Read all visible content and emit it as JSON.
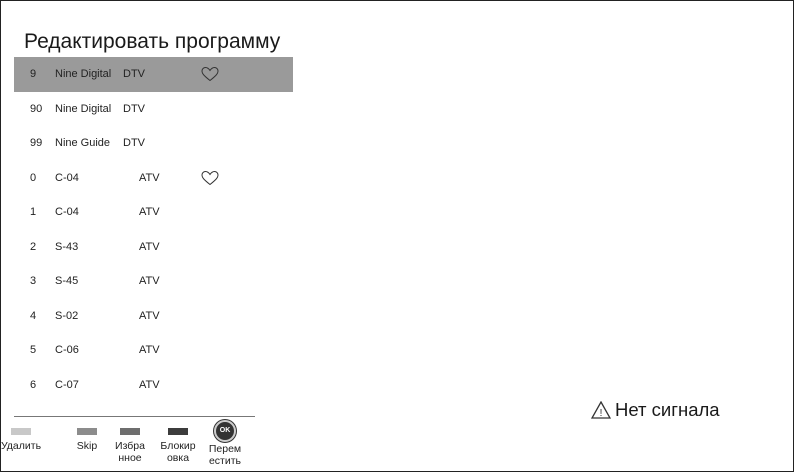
{
  "screen": {
    "title": "Редактировать программу"
  },
  "channels": [
    {
      "num": "9",
      "name": "Nine Digital",
      "type": "DTV",
      "fav": true,
      "selected": true
    },
    {
      "num": "90",
      "name": "Nine Digital",
      "type": "DTV",
      "fav": false,
      "selected": false
    },
    {
      "num": "99",
      "name": "Nine Guide",
      "type": "DTV",
      "fav": false,
      "selected": false
    },
    {
      "num": "0",
      "name": "C-04",
      "type": "ATV",
      "fav": true,
      "selected": false
    },
    {
      "num": "1",
      "name": "C-04",
      "type": "ATV",
      "fav": false,
      "selected": false
    },
    {
      "num": "2",
      "name": "S-43",
      "type": "ATV",
      "fav": false,
      "selected": false
    },
    {
      "num": "3",
      "name": "S-45",
      "type": "ATV",
      "fav": false,
      "selected": false
    },
    {
      "num": "4",
      "name": "S-02",
      "type": "ATV",
      "fav": false,
      "selected": false
    },
    {
      "num": "5",
      "name": "C-06",
      "type": "ATV",
      "fav": false,
      "selected": false
    },
    {
      "num": "6",
      "name": "C-07",
      "type": "ATV",
      "fav": false,
      "selected": false
    }
  ],
  "legend": {
    "delete": {
      "label": "Удалить",
      "color": "#c8c8c8"
    },
    "skip": {
      "label": "Skip",
      "color": "#8c8c8c"
    },
    "fav": {
      "label": "Избра\nнное",
      "color": "#6e6e6e"
    },
    "lock": {
      "label": "Блокир\nовка",
      "color": "#3c3c3c"
    },
    "move": {
      "label": "Перем\nестить",
      "button": "OK"
    }
  },
  "status": {
    "text": "Нет сигнала",
    "icon": "warning-icon"
  }
}
